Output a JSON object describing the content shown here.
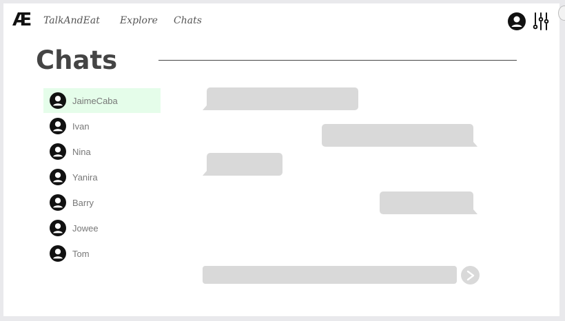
{
  "nav": {
    "logo": "Æ",
    "links": [
      "TalkAndEat",
      "Explore",
      "Chats"
    ]
  },
  "page": {
    "title": "Chats"
  },
  "contacts": [
    {
      "name": "JaimeCaba",
      "selected": true
    },
    {
      "name": "Ivan"
    },
    {
      "name": "Nina"
    },
    {
      "name": "Yanira"
    },
    {
      "name": "Barry"
    },
    {
      "name": "Jowee"
    },
    {
      "name": "Tom"
    }
  ],
  "messages": [
    {
      "side": "left",
      "text": ""
    },
    {
      "side": "right",
      "text": ""
    },
    {
      "side": "left",
      "text": ""
    },
    {
      "side": "right",
      "text": ""
    }
  ],
  "composer": {
    "placeholder": "",
    "send_icon": "chevron-right-icon"
  },
  "colors": {
    "selected_contact_bg": "#e5fdea",
    "bubble_bg": "#d9d9d9",
    "title_text": "#444444",
    "contact_text": "#777777"
  }
}
